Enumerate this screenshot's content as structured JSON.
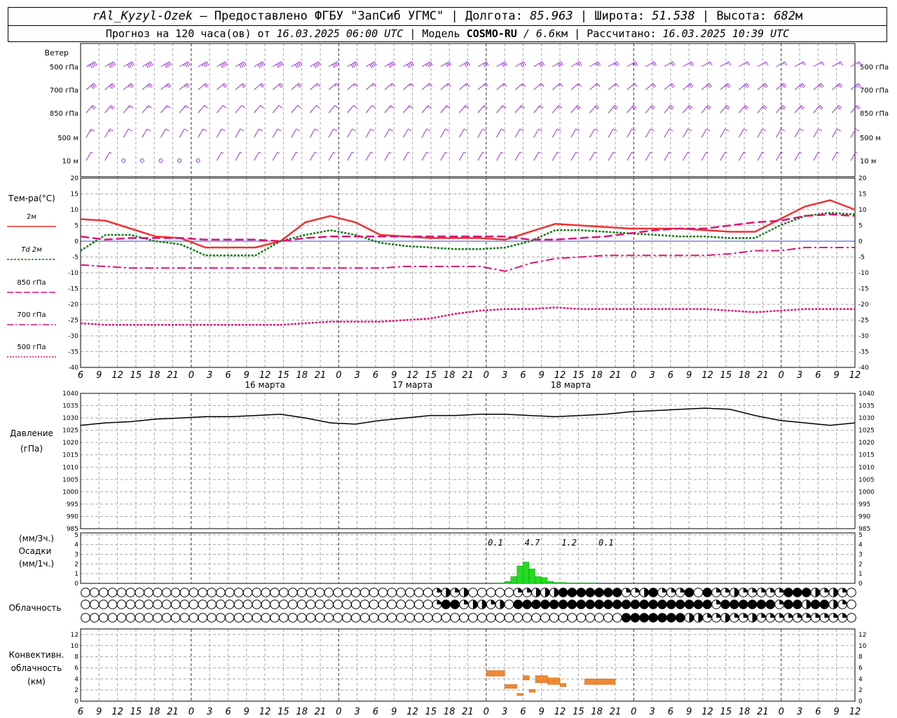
{
  "header": {
    "station": "rAl_Kyzyl-Ozek",
    "provider": "– Предоставлено ФГБУ \"ЗапСиб УГМС\"",
    "lon_label": "Долгота:",
    "lon_value": "85.963",
    "lat_label": "Широта:",
    "lat_value": "51.538",
    "alt_label": "Высота:",
    "alt_value": "682",
    "alt_unit": "м",
    "forecast_label": "Прогноз на 120 часа(ов) от",
    "forecast_start": "16.03.2025 06:00 UTC",
    "model_label": "Модель",
    "model_name": "COSMO-RU",
    "model_res": "/ 6.6",
    "model_res_unit": "км",
    "computed_label": "Рассчитано:",
    "computed_time": "16.03.2025 10:39 UTC"
  },
  "labels": {
    "wind_title": "Ветер",
    "wind_levels": [
      "500 гПа",
      "700 гПа",
      "850 гПа",
      "500 м",
      "10  м"
    ],
    "temp_title": "Тем-ра(°C)",
    "temp_legend": [
      "2м",
      "Td  2м",
      "850 гПа",
      "700 гПа",
      "500 гПа"
    ],
    "pressure_title": "Давление",
    "pressure_unit": "(гПа)",
    "precip_unit3": "(мм/3ч.)",
    "precip_title": "Осадки",
    "precip_unit1": "(мм/1ч.)",
    "cloud_title": "Облачность",
    "conv_title": [
      "Конвективн.",
      "облачность",
      "(км)"
    ]
  },
  "colors": {
    "wind": "#9933cc",
    "t2m": "#ee3333",
    "td2m": "#117711",
    "t850": "#dd1177",
    "t700": "#dd1177",
    "t500": "#dd1177",
    "pressure": "#000000",
    "precip": "#22dd22",
    "conv": "#ee8833",
    "grid": "#aaaaaa"
  },
  "chart_data": [
    {
      "type": "line",
      "title": "Тем-ра(°C)",
      "x_hours": [
        0,
        3,
        6,
        9,
        12,
        15,
        18,
        21,
        24,
        27,
        30,
        33,
        36,
        39,
        42,
        45,
        48,
        51,
        54,
        57,
        60,
        63,
        66,
        69,
        72,
        75,
        78,
        81,
        84,
        87,
        90,
        93,
        96,
        99,
        102,
        105,
        108,
        111,
        114,
        117,
        120
      ],
      "x_tick_labels": [
        "6",
        "9",
        "12",
        "15",
        "18",
        "21",
        "0",
        "3",
        "6",
        "9",
        "12",
        "15",
        "18",
        "21",
        "0",
        "3",
        "6",
        "9",
        "12",
        "15",
        "18",
        "21",
        "0",
        "3",
        "6",
        "9",
        "12",
        "15",
        "18",
        "21",
        "0",
        "3",
        "6",
        "9",
        "12",
        "15",
        "18",
        "21",
        "0",
        "3",
        "6",
        "9",
        "12"
      ],
      "day_labels": [
        "16 марта",
        "17 марта",
        "18 марта"
      ],
      "ylim": [
        -40,
        20
      ],
      "series": [
        {
          "name": "2м",
          "values": [
            7,
            6.5,
            4,
            1.5,
            1,
            -2,
            -2,
            -2,
            0,
            6,
            8,
            6,
            2,
            1.5,
            1,
            1,
            1,
            0.5,
            3,
            5.5,
            5,
            4.5,
            4,
            4,
            4,
            3.5,
            3,
            3,
            7,
            11,
            13,
            10
          ]
        },
        {
          "name": "Td  2м",
          "values": [
            -3,
            2,
            2,
            0,
            -1,
            -4.5,
            -4.5,
            -4.5,
            0,
            2,
            3.5,
            2,
            -0.5,
            -1.5,
            -2,
            -2.5,
            -2.5,
            -2,
            0,
            3.5,
            3.5,
            3,
            2.5,
            2,
            1.5,
            1.5,
            1,
            1,
            5,
            8,
            9,
            8.5
          ]
        },
        {
          "name": "850 гПа",
          "values": [
            1.5,
            0.5,
            1,
            1,
            1,
            0.5,
            0.5,
            0.5,
            0,
            1,
            1.5,
            1.5,
            1.5,
            1.5,
            1.5,
            1.5,
            1.5,
            1.5,
            0.5,
            0.5,
            1,
            1.5,
            2.5,
            3.5,
            4,
            4,
            5,
            6,
            6.5,
            8,
            8.5,
            8
          ]
        },
        {
          "name": "700 гПа",
          "values": [
            -7.5,
            -8,
            -8.5,
            -8.5,
            -8.5,
            -8.5,
            -8.5,
            -8.5,
            -8.5,
            -8.5,
            -8.5,
            -8.5,
            -8.5,
            -8,
            -8,
            -8,
            -8,
            -9.5,
            -7,
            -5.5,
            -5,
            -4.5,
            -4.5,
            -4.5,
            -4.5,
            -4.5,
            -4,
            -3,
            -3,
            -2,
            -2,
            -2
          ]
        },
        {
          "name": "500 гПа",
          "values": [
            -26,
            -26.5,
            -26.5,
            -26.5,
            -26.5,
            -26.5,
            -26.5,
            -26.5,
            -26.5,
            -26,
            -25.5,
            -25.5,
            -25.5,
            -25,
            -24.5,
            -23,
            -22,
            -21.5,
            -21.5,
            -21,
            -21.5,
            -21.5,
            -21.5,
            -21.5,
            -21.5,
            -21.5,
            -22,
            -22.5,
            -22,
            -21.5,
            -21.5,
            -21.5
          ]
        }
      ]
    },
    {
      "type": "line",
      "title": "Давление",
      "ylim": [
        985,
        1040
      ],
      "series": [
        {
          "name": "Давление",
          "values": [
            1027,
            1028,
            1028.5,
            1029.5,
            1030,
            1030.5,
            1030.5,
            1031,
            1031.5,
            1030,
            1028,
            1027.5,
            1029,
            1030,
            1031,
            1031,
            1031.5,
            1031.5,
            1031,
            1030.5,
            1031,
            1031.5,
            1032.5,
            1033,
            1033.5,
            1034,
            1033.5,
            1031,
            1029,
            1028,
            1027,
            1028
          ]
        }
      ]
    },
    {
      "type": "bar",
      "title": "Осадки",
      "ylim": [
        0,
        5
      ],
      "hourly_hours": [
        67,
        68,
        69,
        70,
        71,
        72,
        73,
        74,
        75,
        76,
        77,
        78,
        79,
        80,
        81,
        82,
        83
      ],
      "hourly_values": [
        0.05,
        0.05,
        0.2,
        0.7,
        1.8,
        2.2,
        1.5,
        0.7,
        0.6,
        0.2,
        0.1,
        0.1,
        0.05,
        0.05,
        0.05,
        0.05,
        0.05
      ],
      "three_hour_labels": [
        "0.1",
        "4.7",
        "1.2",
        "0.1"
      ],
      "three_hour_hours": [
        67.5,
        73.5,
        79.5,
        85.5
      ]
    },
    {
      "type": "bar",
      "title": "Конвективн. облачность",
      "ylim": [
        0,
        12
      ],
      "segments": [
        {
          "from": 66,
          "to": 69,
          "bottom": 4.5,
          "top": 5.5
        },
        {
          "from": 69,
          "to": 71,
          "bottom": 2.3,
          "top": 3.0
        },
        {
          "from": 71,
          "to": 72,
          "bottom": 1.0,
          "top": 1.4
        },
        {
          "from": 72,
          "to": 73,
          "bottom": 3.8,
          "top": 4.6
        },
        {
          "from": 73,
          "to": 74,
          "bottom": 1.6,
          "top": 2.1
        },
        {
          "from": 74,
          "to": 76,
          "bottom": 3.3,
          "top": 4.6
        },
        {
          "from": 76,
          "to": 78,
          "bottom": 3.0,
          "top": 4.2
        },
        {
          "from": 78,
          "to": 79,
          "bottom": 2.6,
          "top": 3.2
        },
        {
          "from": 82,
          "to": 87,
          "bottom": 3.0,
          "top": 4.0
        }
      ]
    }
  ],
  "cloud_rows": [
    "oooooooooooooooooooooooooooooooooooooooqhqhoooooqqhhhfffffffqqhfqqqfofqqhqqqqqfffhqhq",
    "oooooooooooooooooooooooooooooooooooooooqffqhhqhoffffffffffffffffffffffqffffffqffhffhq",
    "oooooooooooooooooooooooooooooooooooooooooooooooooooooooooooofffffffhhqqhqqhqqqqqqqqqqo"
  ],
  "wind_rows": [
    [
      45,
      40,
      40,
      40,
      40,
      35,
      35,
      40,
      40,
      40,
      40,
      40,
      40,
      40,
      40,
      40,
      40,
      40,
      35,
      30,
      30,
      30,
      30,
      30,
      30,
      30,
      25,
      25,
      25,
      25,
      20,
      20,
      20,
      15,
      15,
      15,
      15,
      15,
      15,
      15,
      15,
      15
    ],
    [
      30,
      30,
      25,
      25,
      25,
      25,
      20,
      20,
      20,
      20,
      20,
      20,
      15,
      15,
      15,
      15,
      15,
      15,
      15,
      15,
      15,
      15,
      15,
      15,
      15,
      15,
      15,
      15,
      15,
      15,
      20,
      20,
      25,
      25,
      25,
      25,
      25,
      25,
      25,
      25,
      25,
      25
    ],
    [
      20,
      20,
      15,
      15,
      15,
      15,
      10,
      10,
      10,
      10,
      10,
      10,
      10,
      10,
      10,
      10,
      15,
      15,
      15,
      15,
      15,
      15,
      15,
      15,
      15,
      15,
      20,
      20,
      20,
      20,
      20,
      20,
      20,
      20,
      20,
      20,
      20,
      20,
      20,
      20,
      20,
      20
    ],
    [
      15,
      15,
      10,
      10,
      10,
      10,
      10,
      10,
      10,
      10,
      10,
      10,
      10,
      10,
      10,
      10,
      10,
      10,
      10,
      10,
      10,
      10,
      10,
      10,
      10,
      10,
      10,
      10,
      10,
      10,
      10,
      10,
      10,
      10,
      10,
      10,
      10,
      10,
      10,
      10,
      10,
      10
    ],
    [
      5,
      5,
      0,
      0,
      0,
      0,
      0,
      5,
      5,
      5,
      5,
      5,
      5,
      5,
      5,
      5,
      5,
      5,
      5,
      5,
      5,
      5,
      5,
      5,
      5,
      5,
      5,
      5,
      5,
      5,
      5,
      5,
      5,
      5,
      5,
      5,
      5,
      5,
      5,
      5,
      5,
      5
    ]
  ]
}
